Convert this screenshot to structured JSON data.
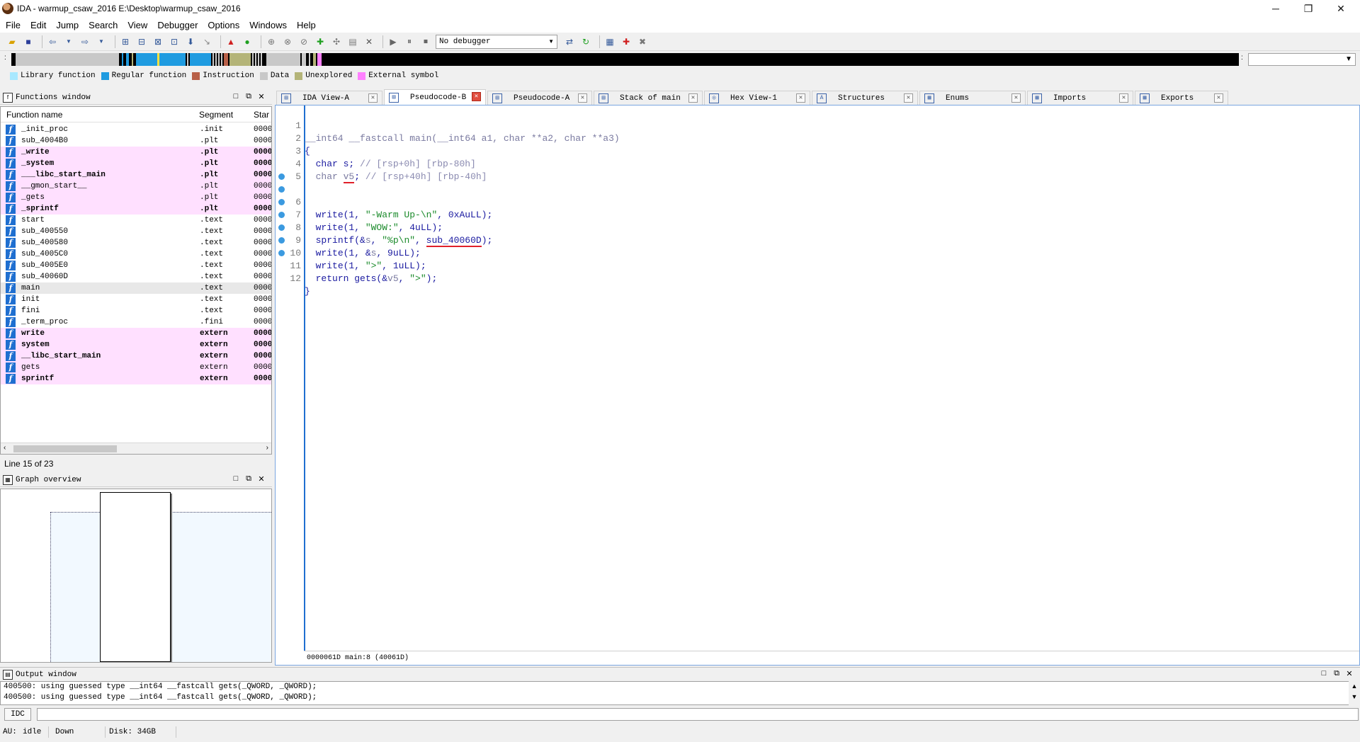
{
  "window": {
    "title": "IDA - warmup_csaw_2016 E:\\Desktop\\warmup_csaw_2016",
    "controls": [
      "─",
      "❐",
      "✕"
    ]
  },
  "menu": [
    "File",
    "Edit",
    "Jump",
    "Search",
    "View",
    "Debugger",
    "Options",
    "Windows",
    "Help"
  ],
  "toolbar": {
    "debugger_select": "No debugger"
  },
  "legend": [
    {
      "label": "Library function",
      "color": "#a8e8ff"
    },
    {
      "label": "Regular function",
      "color": "#1f9be0"
    },
    {
      "label": "Instruction",
      "color": "#b86048"
    },
    {
      "label": "Data",
      "color": "#c8c8c8"
    },
    {
      "label": "Unexplored",
      "color": "#b4b478"
    },
    {
      "label": "External symbol",
      "color": "#ff80ff"
    }
  ],
  "functions_window": {
    "title": "Functions window",
    "columns": {
      "name": "Function name",
      "segment": "Segment",
      "start": "Star"
    },
    "rows": [
      {
        "name": "_init_proc",
        "segment": ".init",
        "start": "0000",
        "style": "normal"
      },
      {
        "name": "sub_4004B0",
        "segment": ".plt",
        "start": "0000",
        "style": "normal"
      },
      {
        "name": "_write",
        "segment": ".plt",
        "start": "0000",
        "style": "pink-bold"
      },
      {
        "name": "_system",
        "segment": ".plt",
        "start": "0000",
        "style": "pink-bold"
      },
      {
        "name": "___libc_start_main",
        "segment": ".plt",
        "start": "0000",
        "style": "pink-bold"
      },
      {
        "name": "__gmon_start__",
        "segment": ".plt",
        "start": "0000",
        "style": "pink"
      },
      {
        "name": "_gets",
        "segment": ".plt",
        "start": "0000",
        "style": "pink"
      },
      {
        "name": "_sprintf",
        "segment": ".plt",
        "start": "0000",
        "style": "pink-bold"
      },
      {
        "name": "start",
        "segment": ".text",
        "start": "0000",
        "style": "normal"
      },
      {
        "name": "sub_400550",
        "segment": ".text",
        "start": "0000",
        "style": "normal"
      },
      {
        "name": "sub_400580",
        "segment": ".text",
        "start": "0000",
        "style": "normal"
      },
      {
        "name": "sub_4005C0",
        "segment": ".text",
        "start": "0000",
        "style": "normal"
      },
      {
        "name": "sub_4005E0",
        "segment": ".text",
        "start": "0000",
        "style": "normal"
      },
      {
        "name": "sub_40060D",
        "segment": ".text",
        "start": "0000",
        "style": "normal"
      },
      {
        "name": "main",
        "segment": ".text",
        "start": "0000",
        "style": "selected"
      },
      {
        "name": "init",
        "segment": ".text",
        "start": "0000",
        "style": "normal"
      },
      {
        "name": "fini",
        "segment": ".text",
        "start": "0000",
        "style": "normal"
      },
      {
        "name": "_term_proc",
        "segment": ".fini",
        "start": "0000",
        "style": "normal"
      },
      {
        "name": "write",
        "segment": "extern",
        "start": "0000",
        "style": "pink-bold"
      },
      {
        "name": "system",
        "segment": "extern",
        "start": "0000",
        "style": "pink-bold"
      },
      {
        "name": "__libc_start_main",
        "segment": "extern",
        "start": "0000",
        "style": "pink-bold"
      },
      {
        "name": "gets",
        "segment": "extern",
        "start": "0000",
        "style": "pink"
      },
      {
        "name": "sprintf",
        "segment": "extern",
        "start": "0000",
        "style": "pink-bold"
      }
    ],
    "status": "Line 15 of 23"
  },
  "graph_overview": {
    "title": "Graph overview"
  },
  "tabs": [
    {
      "label": "IDA View-A",
      "active": false,
      "width": 150
    },
    {
      "label": "Pseudocode-B",
      "active": true,
      "width": 144
    },
    {
      "label": "Pseudocode-A",
      "active": false,
      "width": 148
    },
    {
      "label": "Stack of main",
      "active": false,
      "width": 154
    },
    {
      "label": "Hex View-1",
      "active": false,
      "width": 150
    },
    {
      "label": "Structures",
      "active": false,
      "width": 150
    },
    {
      "label": "Enums",
      "active": false,
      "width": 150
    },
    {
      "label": "Imports",
      "active": false,
      "width": 150
    },
    {
      "label": "Exports",
      "active": false,
      "width": 132
    }
  ],
  "code": {
    "lines": [
      {
        "n": "1",
        "dot": false
      },
      {
        "n": "2",
        "dot": false
      },
      {
        "n": "3",
        "dot": false
      },
      {
        "n": "4",
        "dot": false
      },
      {
        "n": "5",
        "dot": false
      },
      {
        "n": "6",
        "dot": true
      },
      {
        "n": "7",
        "dot": true
      },
      {
        "n": "8",
        "dot": true
      },
      {
        "n": "9",
        "dot": true
      },
      {
        "n": "10",
        "dot": true
      },
      {
        "n": "11",
        "dot": true
      },
      {
        "n": "12",
        "dot": true
      }
    ],
    "tokens": {
      "l1": "__int64 __fastcall main(__int64 a1, char **a2, char **a3)",
      "l2": "{",
      "l3_decl": "char s;",
      "l3_cm": " // [rsp+0h] [rbp-80h]",
      "l4_type": "char ",
      "l4_var": "v5",
      "l4_semi": ";",
      "l4_cm": " // [rsp+40h] [rbp-40h]",
      "l6_fn": "write(1, ",
      "l6_str": "\"-Warm Up-\\n\"",
      "l6_rest": ", 0xAuLL);",
      "l7_fn": "write(1, ",
      "l7_str": "\"WOW:\"",
      "l7_rest": ", 4uLL);",
      "l8_fn": "sprintf(&",
      "l8_s": "s",
      "l8_mid": ", ",
      "l8_str": "\"%p\\n\"",
      "l8_comma": ", ",
      "l8_sub": "sub_40060D",
      "l8_end": ");",
      "l9_fn": "write(1, &",
      "l9_s": "s",
      "l9_rest": ", 9uLL);",
      "l10_fn": "write(1, ",
      "l10_str": "\">\"",
      "l10_rest": ", 1uLL);",
      "l11_ret": "return gets(&",
      "l11_v5": "v5",
      "l11_mid": ", ",
      "l11_str": "\">\"",
      "l11_end": ");",
      "l12": "}"
    },
    "status": "0000061D main:8 (40061D)"
  },
  "output": {
    "title": "Output window",
    "lines": [
      "400500: using guessed type __int64 __fastcall gets(_QWORD, _QWORD);",
      "400500: using guessed type __int64 __fastcall gets(_QWORD, _QWORD);"
    ],
    "idc_label": "IDC"
  },
  "statusbar": {
    "au": "AU:",
    "state": "idle",
    "direction": "Down",
    "disk": "Disk: 34GB"
  }
}
